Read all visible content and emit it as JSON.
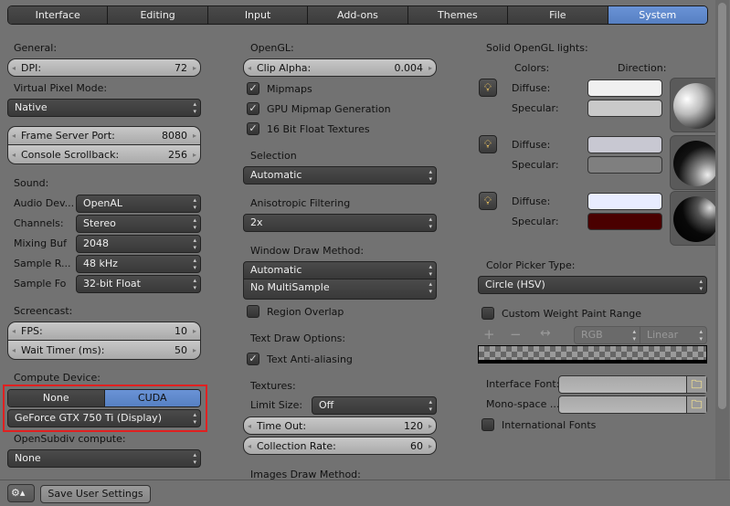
{
  "tabs": [
    "Interface",
    "Editing",
    "Input",
    "Add-ons",
    "Themes",
    "File",
    "System"
  ],
  "active_tab": "System",
  "left": {
    "general": "General:",
    "dpi_label": "DPI:",
    "dpi": "72",
    "vpm_label": "Virtual Pixel Mode:",
    "vpm": "Native",
    "fsp_label": "Frame Server Port:",
    "fsp": "8080",
    "cs_label": "Console Scrollback:",
    "cs": "256",
    "sound": "Sound:",
    "sound_rows": [
      [
        "Audio Dev...",
        "OpenAL"
      ],
      [
        "Channels:",
        "Stereo"
      ],
      [
        "Mixing Buf",
        "2048"
      ],
      [
        "Sample R...",
        "48 kHz"
      ],
      [
        "Sample Fo",
        "32-bit Float"
      ]
    ],
    "screencast": "Screencast:",
    "fps_label": "FPS:",
    "fps": "10",
    "wait_label": "Wait Timer (ms):",
    "wait": "50",
    "compute": "Compute Device:",
    "none": "None",
    "cuda": "CUDA",
    "gpu": "GeForce GTX 750 Ti (Display)",
    "osd_label": "OpenSubdiv compute:",
    "osd": "None"
  },
  "mid": {
    "opengl": "OpenGL:",
    "clip_label": "Clip Alpha:",
    "clip": "0.004",
    "mipmaps": "Mipmaps",
    "gpu_mip": "GPU Mipmap Generation",
    "float16": "16 Bit Float Textures",
    "selection": "Selection",
    "selection_val": "Automatic",
    "aniso": "Anisotropic Filtering",
    "aniso_val": "2x",
    "wdm": "Window Draw Method:",
    "wdm_val": "Automatic",
    "msaa": "No MultiSample",
    "region_overlap": "Region Overlap",
    "text_draw": "Text Draw Options:",
    "text_aa": "Text Anti-aliasing",
    "textures": "Textures:",
    "limit_label": "Limit Size:",
    "limit": "Off",
    "timeout_label": "Time Out:",
    "timeout": "120",
    "coll_label": "Collection Rate:",
    "coll": "60",
    "images_draw": "Images Draw Method:"
  },
  "right": {
    "lights": "Solid OpenGL lights:",
    "colors": "Colors:",
    "direction": "Direction:",
    "diffuse": "Diffuse:",
    "specular": "Specular:",
    "light_colors": [
      [
        "#f0f0f0",
        "#c9c9c9"
      ],
      [
        "#c8c8d2",
        "#7f7f7f"
      ],
      [
        "#e8ecff",
        "#4a0000"
      ]
    ],
    "picker_label": "Color Picker Type:",
    "picker": "Circle (HSV)",
    "cwpr": "Custom Weight Paint Range",
    "rgb": "RGB",
    "linear": "Linear",
    "iface_font": "Interface Font:",
    "mono_font": "Mono-space ...",
    "intl": "International Fonts"
  },
  "bottom": {
    "save": "Save User Settings"
  },
  "colors": {
    "accent": "#5680c2",
    "highlight_box": "#e02020"
  }
}
